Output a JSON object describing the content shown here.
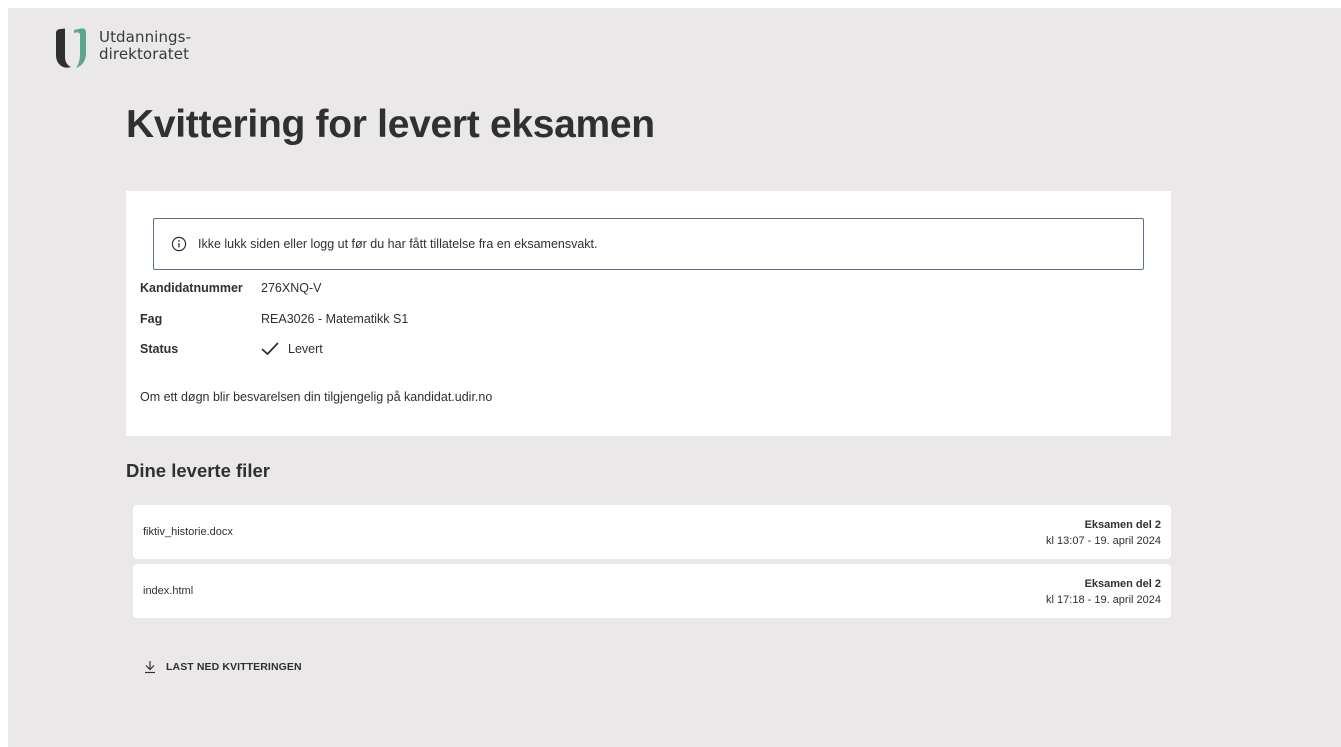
{
  "header": {
    "logo_line1": "Utdannings-",
    "logo_line2": "direktoratet"
  },
  "page_title": "Kvittering for levert eksamen",
  "alert": {
    "icon": "info-circle-icon",
    "text": "Ikke lukk siden eller logg ut før du har fått tillatelse fra en eksamensvakt."
  },
  "info": {
    "candidate_label": "Kandidatnummer",
    "candidate_value": "276XNQ-V",
    "subject_label": "Fag",
    "subject_value": "REA3026 - Matematikk S1",
    "status_label": "Status",
    "status_value": "Levert",
    "status_icon": "checkmark-icon"
  },
  "note": "Om ett døgn blir besvarelsen din tilgjengelig på kandidat.udir.no",
  "files_section": {
    "title": "Dine leverte filer",
    "files": [
      {
        "name": "fiktiv_historie.docx",
        "part": "Eksamen del 2",
        "time": "kl 13:07 - 19. april 2024"
      },
      {
        "name": "index.html",
        "part": "Eksamen del 2",
        "time": "kl 17:18 - 19. april 2024"
      }
    ]
  },
  "download": {
    "label": "LAST NED KVITTERINGEN",
    "icon": "download-icon"
  },
  "colors": {
    "background": "#eae8e8",
    "card": "#ffffff",
    "alert_border": "#5d7188",
    "logo_dark": "#2f2f2f",
    "logo_green": "#5ea58a"
  }
}
